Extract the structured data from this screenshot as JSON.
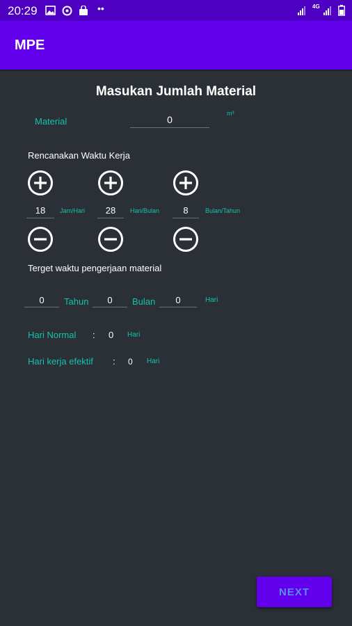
{
  "status_bar": {
    "time": "20:29",
    "network_label": "4G"
  },
  "app_bar": {
    "title": "MPE"
  },
  "heading": "Masukan Jumlah Material",
  "material": {
    "label": "Material",
    "value": "0",
    "unit": "m³"
  },
  "plan": {
    "title": "Rencanakan Waktu Kerja",
    "items": [
      {
        "value": "18",
        "unit": "Jam/Hari"
      },
      {
        "value": "28",
        "unit": "Hari/Bulan"
      },
      {
        "value": "8",
        "unit": "Bulan/Tahun"
      }
    ]
  },
  "target": {
    "title": "Terget waktu pengerjaan material",
    "years": {
      "value": "0",
      "unit": "Tahun"
    },
    "months": {
      "value": "0",
      "unit": "Bulan"
    },
    "days": {
      "value": "0",
      "unit": "Hari"
    }
  },
  "results": {
    "normal": {
      "label": "Hari Normal",
      "sep": ":",
      "value": "0",
      "unit": "Hari"
    },
    "effective": {
      "label": "Hari kerja efektif",
      "sep": ":",
      "value": "0",
      "unit": "Hari"
    }
  },
  "next_button": "NEXT",
  "colors": {
    "status_bar": "#4d00c2",
    "app_bar": "#6200ee",
    "background": "#2a3035",
    "accent_text": "#14c2b0",
    "button_text": "#5b8cf0"
  }
}
